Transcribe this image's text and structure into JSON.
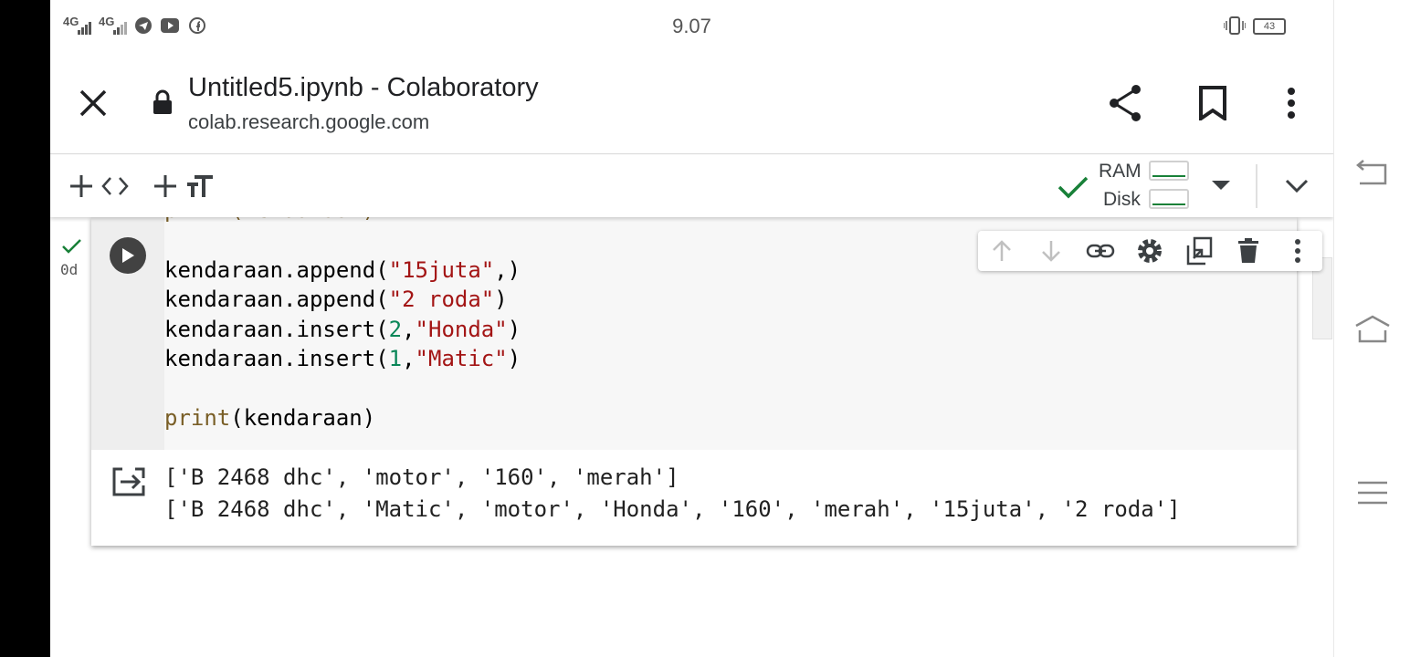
{
  "status_bar": {
    "signal_1": "4G",
    "signal_2": "4G",
    "time": "9.07",
    "battery": "43"
  },
  "browser": {
    "title": "Untitled5.ipynb - Colaboratory",
    "url": "colab.research.google.com"
  },
  "toolbar": {
    "ram_label": "RAM",
    "disk_label": "Disk"
  },
  "cell": {
    "exec_time": "0d",
    "code_partial_top": "print(kendaraan)",
    "code_lines": [
      {
        "parts": [
          {
            "t": "kendaraan.append(",
            "c": "plain"
          },
          {
            "t": "\"15juta\"",
            "c": "str"
          },
          {
            "t": ",)",
            "c": "plain"
          }
        ]
      },
      {
        "parts": [
          {
            "t": "kendaraan.append(",
            "c": "plain"
          },
          {
            "t": "\"2 roda\"",
            "c": "str"
          },
          {
            "t": ")",
            "c": "plain"
          }
        ]
      },
      {
        "parts": [
          {
            "t": "kendaraan.insert(",
            "c": "plain"
          },
          {
            "t": "2",
            "c": "num"
          },
          {
            "t": ",",
            "c": "plain"
          },
          {
            "t": "\"Honda\"",
            "c": "str"
          },
          {
            "t": ")",
            "c": "plain"
          }
        ]
      },
      {
        "parts": [
          {
            "t": "kendaraan.insert(",
            "c": "plain"
          },
          {
            "t": "1",
            "c": "num"
          },
          {
            "t": ",",
            "c": "plain"
          },
          {
            "t": "\"Matic\"",
            "c": "str"
          },
          {
            "t": ")",
            "c": "plain"
          }
        ]
      },
      {
        "parts": []
      },
      {
        "parts": [
          {
            "t": "print",
            "c": "kw"
          },
          {
            "t": "(kendaraan)",
            "c": "plain"
          }
        ]
      }
    ],
    "output_lines": [
      "['B 2468 dhc', 'motor', '160', 'merah']",
      "['B 2468 dhc', 'Matic', 'motor', 'Honda', '160', 'merah', '15juta', '2 roda']"
    ]
  },
  "colors": {
    "check_green": "#188038",
    "string_red": "#a31515",
    "number_green": "#098658",
    "keyword_brown": "#795e26"
  }
}
